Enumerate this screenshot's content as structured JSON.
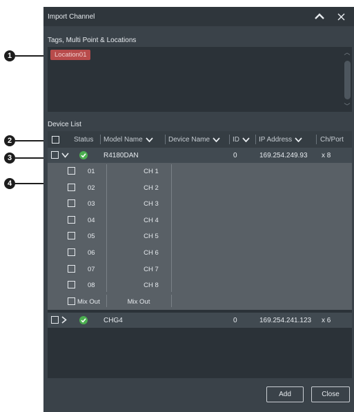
{
  "window": {
    "title": "Import Channel"
  },
  "tags_section": {
    "label": "Tags, Multi Point & Locations",
    "tags": [
      "Location01"
    ]
  },
  "device_list": {
    "label": "Device List",
    "columns": {
      "status": "Status",
      "model_name": "Model Name",
      "device_name": "Device Name",
      "id": "ID",
      "ip_address": "IP Address",
      "ch_port": "Ch/Port"
    },
    "devices": [
      {
        "model": "R4180DAN",
        "id": "0",
        "ip": "169.254.249.93",
        "ch": "x 8",
        "expanded": true
      },
      {
        "model": "CHG4",
        "id": "0",
        "ip": "169.254.241.123",
        "ch": "x 6",
        "expanded": false
      }
    ],
    "channels": [
      {
        "no": "01",
        "name": "CH 1"
      },
      {
        "no": "02",
        "name": "CH 2"
      },
      {
        "no": "03",
        "name": "CH 3"
      },
      {
        "no": "04",
        "name": "CH 4"
      },
      {
        "no": "05",
        "name": "CH 5"
      },
      {
        "no": "06",
        "name": "CH 6"
      },
      {
        "no": "07",
        "name": "CH 7"
      },
      {
        "no": "08",
        "name": "CH 8"
      },
      {
        "no": "Mix Out",
        "name": "Mix Out"
      }
    ]
  },
  "buttons": {
    "add": "Add",
    "close": "Close"
  },
  "callouts": [
    "1",
    "2",
    "3",
    "4"
  ],
  "colors": {
    "tag_red": "#b84b4b",
    "status_green": "#4caf50",
    "window_bg": "#3a4249"
  }
}
